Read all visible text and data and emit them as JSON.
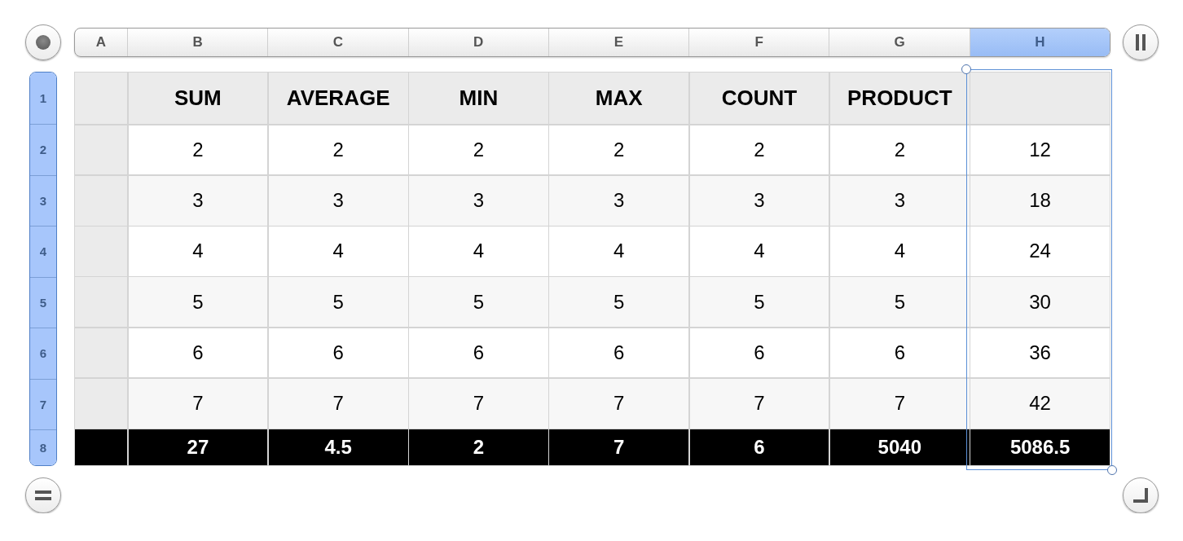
{
  "columns": [
    {
      "label": "A",
      "selected": false
    },
    {
      "label": "B",
      "selected": false
    },
    {
      "label": "C",
      "selected": false
    },
    {
      "label": "D",
      "selected": false
    },
    {
      "label": "E",
      "selected": false
    },
    {
      "label": "F",
      "selected": false
    },
    {
      "label": "G",
      "selected": false
    },
    {
      "label": "H",
      "selected": true
    }
  ],
  "rows": [
    {
      "number": "1",
      "selected": true,
      "kind": "header",
      "cells": [
        "SUM",
        "AVERAGE",
        "MIN",
        "MAX",
        "COUNT",
        "PRODUCT"
      ]
    },
    {
      "number": "2",
      "selected": true,
      "kind": "body",
      "cells": [
        "2",
        "2",
        "2",
        "2",
        "2",
        "2",
        "12"
      ]
    },
    {
      "number": "3",
      "selected": true,
      "kind": "body",
      "cells": [
        "3",
        "3",
        "3",
        "3",
        "3",
        "3",
        "18"
      ]
    },
    {
      "number": "4",
      "selected": true,
      "kind": "body",
      "cells": [
        "4",
        "4",
        "4",
        "4",
        "4",
        "4",
        "24"
      ]
    },
    {
      "number": "5",
      "selected": true,
      "kind": "body",
      "cells": [
        "5",
        "5",
        "5",
        "5",
        "5",
        "5",
        "30"
      ]
    },
    {
      "number": "6",
      "selected": true,
      "kind": "body",
      "cells": [
        "6",
        "6",
        "6",
        "6",
        "6",
        "6",
        "36"
      ]
    },
    {
      "number": "7",
      "selected": true,
      "kind": "body",
      "cells": [
        "7",
        "7",
        "7",
        "7",
        "7",
        "7",
        "42"
      ]
    },
    {
      "number": "8",
      "selected": true,
      "kind": "footer",
      "cells": [
        "27",
        "4.5",
        "2",
        "7",
        "6",
        "5040",
        "5086.5"
      ]
    }
  ]
}
